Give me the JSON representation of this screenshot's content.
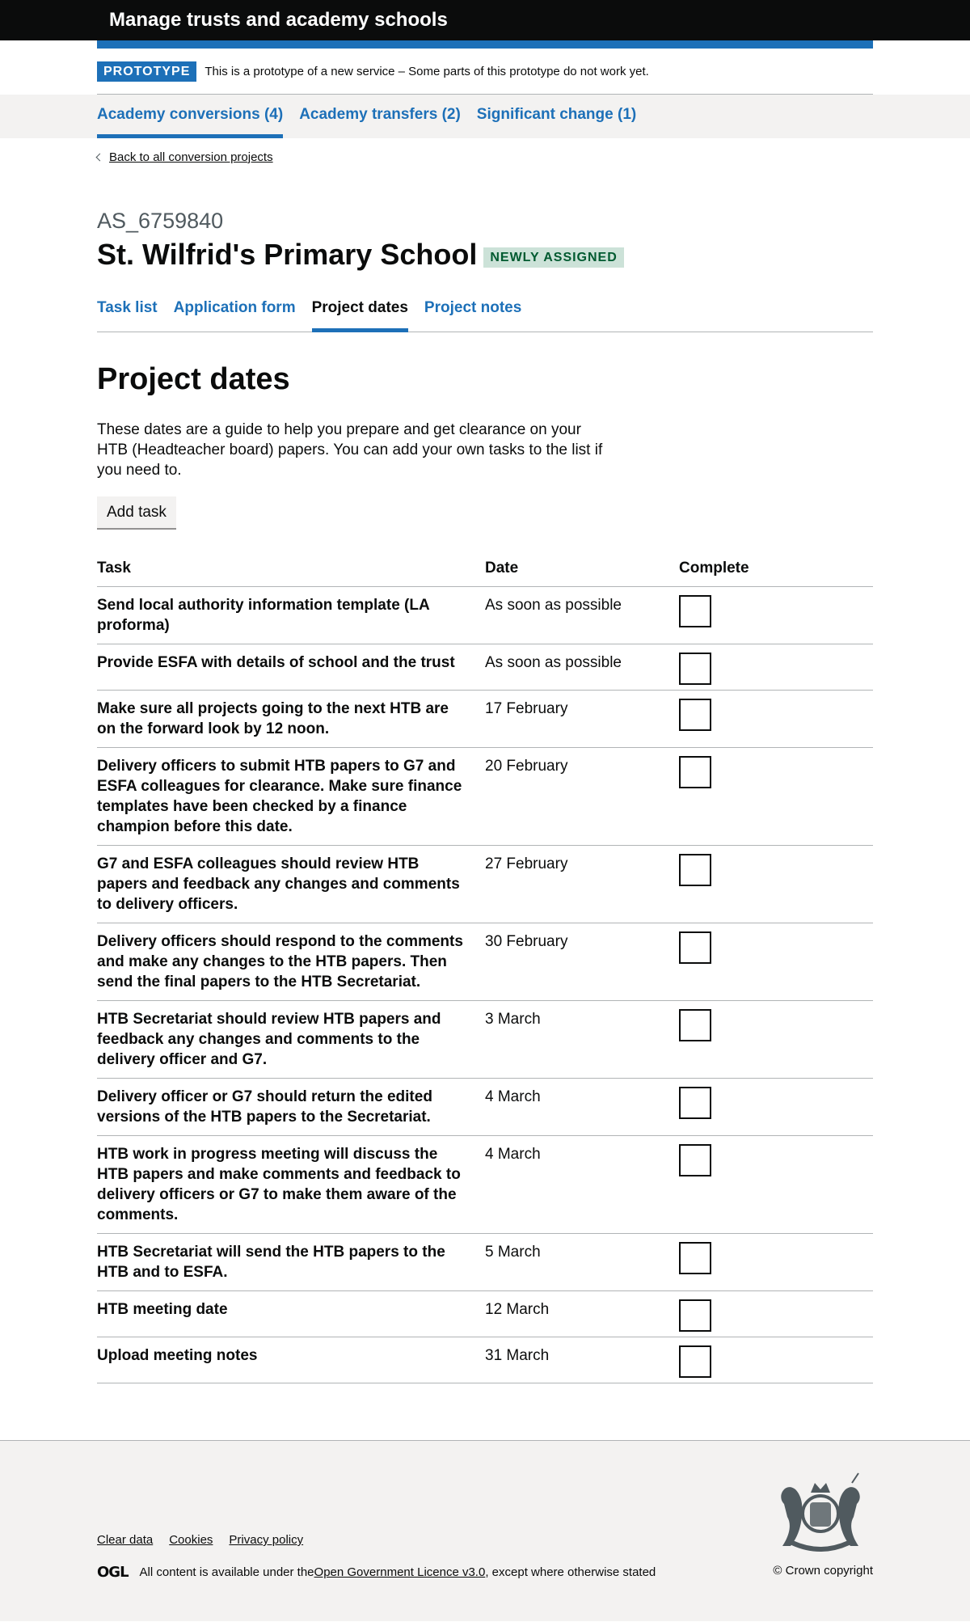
{
  "header": {
    "service_name": "Manage trusts and academy schools"
  },
  "phase_banner": {
    "tag": "PROTOTYPE",
    "text": "This is a prototype of a new service – Some parts of this prototype do not work yet."
  },
  "primary_nav": [
    {
      "label": "Academy conversions (4)",
      "active": true
    },
    {
      "label": "Academy transfers (2)",
      "active": false
    },
    {
      "label": "Significant change (1)",
      "active": false
    }
  ],
  "back_link": "Back to all conversion projects",
  "project": {
    "reference": "AS_6759840",
    "name": "St. Wilfrid's Primary School",
    "status_tag": "NEWLY ASSIGNED"
  },
  "sub_nav": [
    {
      "label": "Task list",
      "active": false
    },
    {
      "label": "Application form",
      "active": false
    },
    {
      "label": "Project dates",
      "active": true
    },
    {
      "label": "Project notes",
      "active": false
    }
  ],
  "main": {
    "heading": "Project dates",
    "intro": "These dates are a guide to help you prepare and get clearance on your HTB (Headteacher board) papers. You can add your own tasks to the list if you need to.",
    "add_task_label": "Add task"
  },
  "table": {
    "headers": [
      "Task",
      "Date",
      "Complete"
    ],
    "rows": [
      {
        "task": "Send local authority information template (LA proforma)",
        "date": "As soon as possible"
      },
      {
        "task": "Provide ESFA with details of school and the trust",
        "date": "As soon as possible"
      },
      {
        "task": "Make sure all projects going to the next HTB are on the forward look by 12 noon.",
        "date": "17 February"
      },
      {
        "task": "Delivery officers to submit HTB papers to G7 and ESFA colleagues for clearance. Make sure finance templates have been checked by a finance champion before this date.",
        "date": "20 February"
      },
      {
        "task": "G7 and ESFA colleagues should review HTB papers and feedback any changes and comments to delivery officers.",
        "date": "27 February"
      },
      {
        "task": "Delivery officers should respond to the comments and make any changes to the HTB papers. Then send the final papers to the HTB Secretariat.",
        "date": "30 February"
      },
      {
        "task": "HTB Secretariat should review HTB papers and feedback any changes and comments to the delivery officer and G7.",
        "date": "3 March"
      },
      {
        "task": "Delivery officer or G7 should return the edited versions of the HTB papers to the Secretariat.",
        "date": "4 March"
      },
      {
        "task": "HTB work in progress meeting will discuss the HTB papers and make comments and feedback to delivery officers or G7 to make them aware of the comments.",
        "date": "4 March"
      },
      {
        "task": "HTB Secretariat will send the HTB papers to the HTB and to ESFA.",
        "date": "5 March"
      },
      {
        "task": "HTB meeting date",
        "date": "12 March"
      },
      {
        "task": "Upload meeting notes",
        "date": "31 March"
      }
    ]
  },
  "footer": {
    "links": [
      "Clear data",
      "Cookies",
      "Privacy policy"
    ],
    "ogl_logo": "OGL",
    "licence_prefix": "All content is available under the ",
    "licence_link": "Open Government Licence v3.0",
    "licence_suffix": ", except where otherwise stated",
    "copyright": "© Crown copyright",
    "crest_icon": "royal-coat-of-arms-icon"
  }
}
